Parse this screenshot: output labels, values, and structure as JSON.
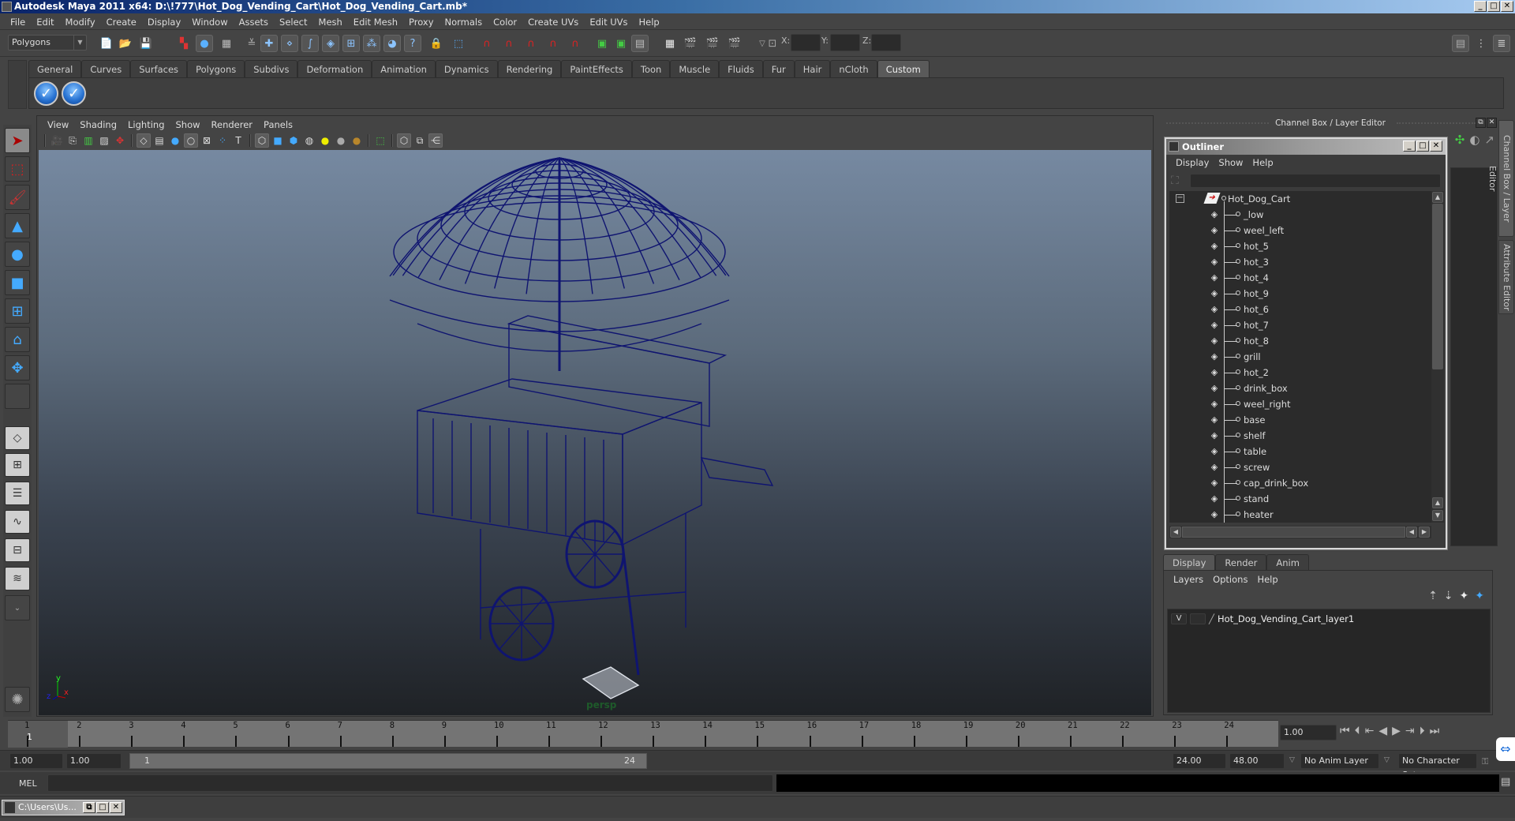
{
  "window": {
    "title": "Autodesk Maya 2011 x64: D:\\!777\\Hot_Dog_Vending_Cart\\Hot_Dog_Vending_Cart.mb*",
    "controls": [
      "minimize",
      "maximize",
      "close"
    ]
  },
  "menubar": [
    "File",
    "Edit",
    "Modify",
    "Create",
    "Display",
    "Window",
    "Assets",
    "Select",
    "Mesh",
    "Edit Mesh",
    "Proxy",
    "Normals",
    "Color",
    "Create UVs",
    "Edit UVs",
    "Help"
  ],
  "statusline": {
    "mode": "Polygons",
    "xyz_labels": [
      "X:",
      "Y:",
      "Z:"
    ],
    "xyz_values": [
      "",
      "",
      ""
    ]
  },
  "shelf": {
    "tabs": [
      "General",
      "Curves",
      "Surfaces",
      "Polygons",
      "Subdivs",
      "Deformation",
      "Animation",
      "Dynamics",
      "Rendering",
      "PaintEffects",
      "Toon",
      "Muscle",
      "Fluids",
      "Fur",
      "Hair",
      "nCloth",
      "Custom"
    ],
    "active_tab": "Custom",
    "buttons": [
      "checkmark-icon",
      "checkmark-icon"
    ]
  },
  "viewport": {
    "menu": [
      "View",
      "Shading",
      "Lighting",
      "Show",
      "Renderer",
      "Panels"
    ],
    "camera_label": "persp",
    "axis": {
      "x": "x",
      "y": "y",
      "z": "z"
    },
    "wire_color": "#0f1470"
  },
  "channel_box": {
    "title": "Channel Box / Layer Editor",
    "side_tabs": [
      "Channel Box / Layer Editor",
      "Attribute Editor"
    ]
  },
  "outliner": {
    "title": "Outliner",
    "menu": [
      "Display",
      "Show",
      "Help"
    ],
    "filter_value": "",
    "root": "Hot_Dog_Cart",
    "children": [
      "_low",
      "weel_left",
      "hot_5",
      "hot_3",
      "hot_4",
      "hot_9",
      "hot_6",
      "hot_7",
      "hot_8",
      "grill",
      "hot_2",
      "drink_box",
      "weel_right",
      "base",
      "shelf",
      "table",
      "screw",
      "cap_drink_box",
      "stand",
      "heater"
    ]
  },
  "layer_editor": {
    "tabs": [
      "Display",
      "Render",
      "Anim"
    ],
    "active_tab": "Display",
    "menu": [
      "Layers",
      "Options",
      "Help"
    ],
    "layers": [
      {
        "visible": "V",
        "name": "Hot_Dog_Vending_Cart_layer1"
      }
    ]
  },
  "time_slider": {
    "ticks": [
      "1",
      "2",
      "3",
      "4",
      "5",
      "6",
      "7",
      "8",
      "9",
      "10",
      "11",
      "12",
      "13",
      "14",
      "15",
      "16",
      "17",
      "18",
      "19",
      "20",
      "21",
      "22",
      "23",
      "24"
    ],
    "current_frame_label": "1",
    "current_time": "1.00"
  },
  "range_slider": {
    "start_time": "1.00",
    "playback_start": "1.00",
    "range_start_label": "1",
    "range_end_label": "24",
    "playback_end": "24.00",
    "end_time": "48.00",
    "anim_layer": "No Anim Layer",
    "character_set": "No Character Set"
  },
  "command_line": {
    "label": "MEL",
    "input": ""
  },
  "taskbar": {
    "minimized_window": "C:\\Users\\Us..."
  }
}
